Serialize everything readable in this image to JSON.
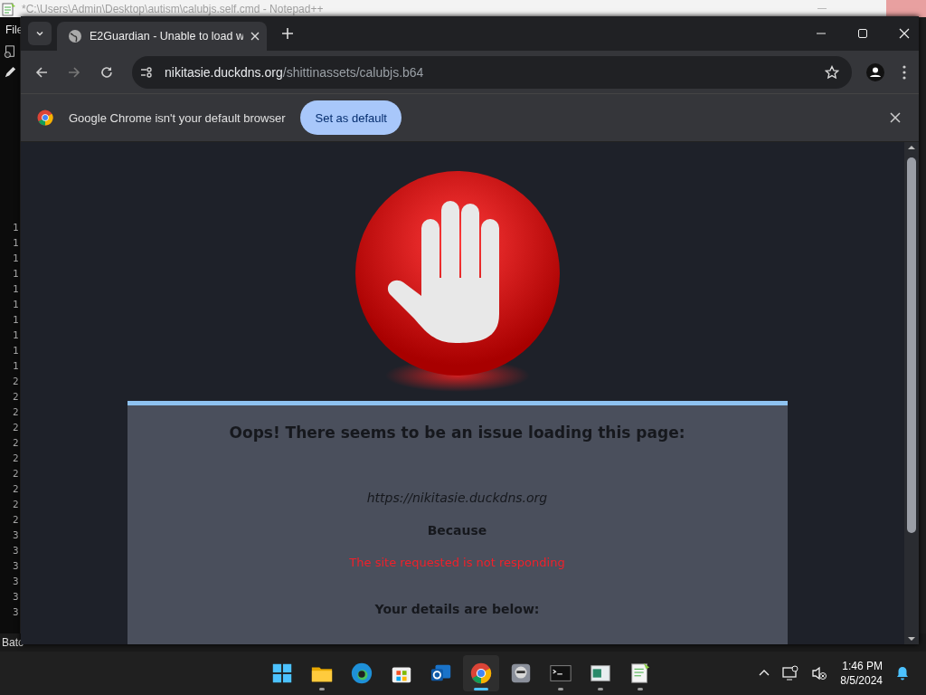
{
  "notepad": {
    "title": "*C:\\Users\\Admin\\Desktop\\autism\\calubjs.self.cmd - Notepad++",
    "menu": [
      "File"
    ],
    "line_numbers": [
      "1",
      "1",
      "1",
      "1",
      "1",
      "1",
      "1",
      "1",
      "1",
      "1",
      "2",
      "2",
      "2",
      "2",
      "2",
      "2",
      "2",
      "2",
      "2",
      "2",
      "3",
      "3",
      "3",
      "3",
      "3",
      "3"
    ],
    "status": "Batc"
  },
  "browser": {
    "tabs": [
      {
        "title": "E2Guardian - Unable to load w",
        "selected": true
      }
    ],
    "url": {
      "host": "nikitasie.duckdns.org",
      "path": "/shittinassets/calubjs.b64"
    },
    "infobar": {
      "message": "Google Chrome isn't your default browser",
      "button": "Set as default"
    }
  },
  "page": {
    "heading": "Oops! There seems to be an issue loading this page:",
    "url": "https://nikitasie.duckdns.org",
    "because": "Because",
    "reason": "The site requested is not responding",
    "details": "Your details are below:"
  },
  "taskbar": {
    "apps": [
      {
        "kind": "start",
        "running": false,
        "selected": false
      },
      {
        "kind": "files",
        "running": true,
        "selected": false
      },
      {
        "kind": "edge",
        "running": false,
        "selected": false
      },
      {
        "kind": "store",
        "running": false,
        "selected": false
      },
      {
        "kind": "mail",
        "running": false,
        "selected": false
      },
      {
        "kind": "chrome",
        "running": true,
        "selected": true
      },
      {
        "kind": "game",
        "running": false,
        "selected": false
      },
      {
        "kind": "terminal",
        "running": true,
        "selected": false
      },
      {
        "kind": "window",
        "running": true,
        "selected": false
      },
      {
        "kind": "notepad",
        "running": true,
        "selected": false
      }
    ],
    "time": "1:46 PM",
    "date": "8/5/2024"
  }
}
